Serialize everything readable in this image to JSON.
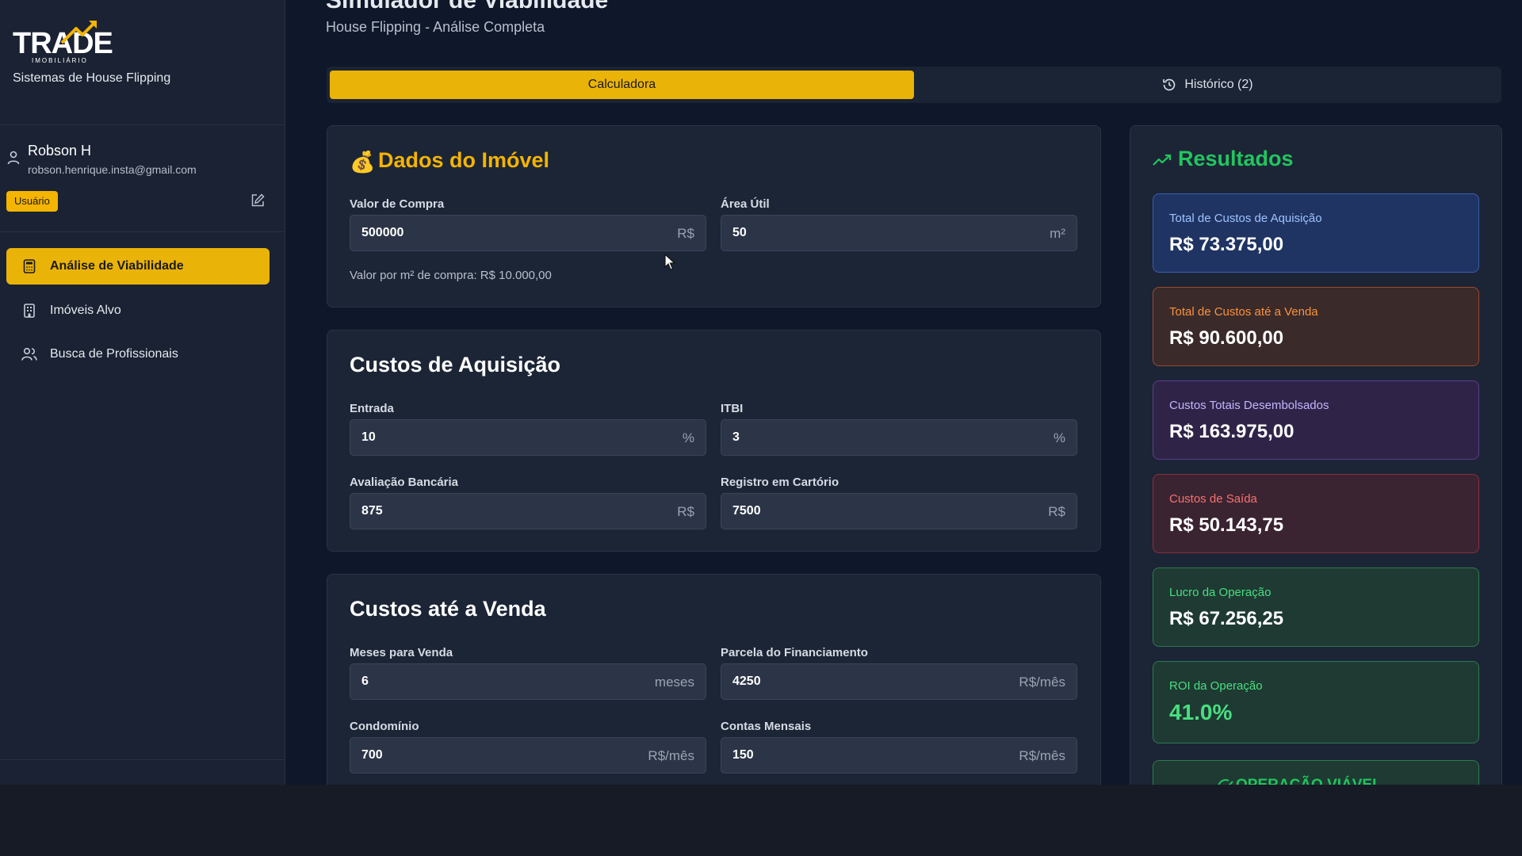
{
  "brand": {
    "logo_text": "TRADE",
    "logo_sub": "IMOBILIÁRIO",
    "subtitle": "Sistemas de House Flipping"
  },
  "user": {
    "name": "Robson H",
    "email": "robson.henrique.insta@gmail.com",
    "role_badge": "Usuário"
  },
  "nav": [
    {
      "label": "Análise de Viabilidade",
      "icon": "calculator-icon",
      "active": true
    },
    {
      "label": "Imóveis Alvo",
      "icon": "building-icon",
      "active": false
    },
    {
      "label": "Busca de Profissionais",
      "icon": "users-icon",
      "active": false
    }
  ],
  "header": {
    "title": "Simulador de Viabilidade",
    "subtitle": "House Flipping - Análise Completa"
  },
  "tabs": {
    "calculator": "Calculadora",
    "history": "Histórico (2)"
  },
  "property": {
    "title": "Dados do Imóvel",
    "emoji": "💰",
    "purchase_label": "Valor de Compra",
    "purchase_value": "500000",
    "purchase_unit": "R$",
    "area_label": "Área Útil",
    "area_value": "50",
    "area_unit": "m²",
    "helper": "Valor por m² de compra: R$ 10.000,00"
  },
  "acquisition": {
    "title": "Custos de Aquisição",
    "entrada_label": "Entrada",
    "entrada_value": "10",
    "entrada_unit": "%",
    "itbi_label": "ITBI",
    "itbi_value": "3",
    "itbi_unit": "%",
    "avaliacao_label": "Avaliação Bancária",
    "avaliacao_value": "875",
    "avaliacao_unit": "R$",
    "registro_label": "Registro em Cartório",
    "registro_value": "7500",
    "registro_unit": "R$"
  },
  "sale_costs": {
    "title": "Custos até a Venda",
    "meses_label": "Meses para Venda",
    "meses_value": "6",
    "meses_unit": "meses",
    "parcela_label": "Parcela do Financiamento",
    "parcela_value": "4250",
    "parcela_unit": "R$/mês",
    "condominio_label": "Condomínio",
    "condominio_value": "700",
    "condominio_unit": "R$/mês",
    "contas_label": "Contas Mensais",
    "contas_value": "150",
    "contas_unit": "R$/mês"
  },
  "results": {
    "title": "Resultados",
    "items": [
      {
        "label": "Total de Custos de Aquisição",
        "value": "R$ 73.375,00",
        "color": "#9ec3ff"
      },
      {
        "label": "Total de Custos até a Venda",
        "value": "R$ 90.600,00",
        "color": "#fb923c"
      },
      {
        "label": "Custos Totais Desembolsados",
        "value": "R$ 163.975,00",
        "color": "#c4b5fd"
      },
      {
        "label": "Custos de Saída",
        "value": "R$ 50.143,75",
        "color": "#f87171"
      },
      {
        "label": "Lucro da Operação",
        "value": "R$ 67.256,25",
        "color": "#4ade80"
      },
      {
        "label": "ROI da Operação",
        "value": "41.0%",
        "color": "#4ade80"
      }
    ],
    "verdict": "OPERAÇÃO VIÁVEL"
  },
  "colors": {
    "accent": "#eab308",
    "success": "#22c55e",
    "background": "#0f172a",
    "card": "#1c2536"
  }
}
